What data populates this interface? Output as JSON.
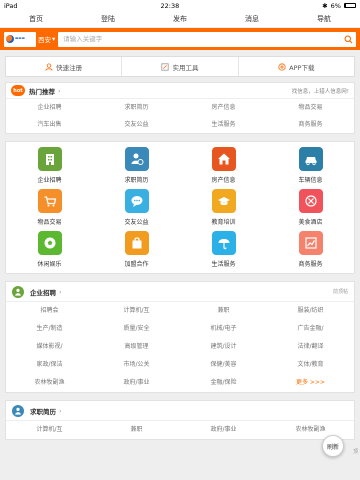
{
  "status_bar": {
    "device": "iPad",
    "time": "22:38",
    "battery": "6%"
  },
  "topnav": [
    "首页",
    "登陆",
    "发布",
    "消息",
    "导航"
  ],
  "search": {
    "city": "西安",
    "placeholder": "请输入关键字"
  },
  "quick_links": [
    "快速注册",
    "实用工具",
    "APP下载"
  ],
  "hot": {
    "badge": "hot",
    "title": "热门推荐",
    "arrow": "›",
    "tip": "找信息，上猎人信息网!",
    "items": [
      "企业招聘",
      "求职简历",
      "房产信息",
      "物品交易",
      "汽车出售",
      "交友公益",
      "生活服务",
      "商务服务"
    ]
  },
  "categories": [
    {
      "label": "企业招聘",
      "icon": "building-icon",
      "color": "#6aa53b"
    },
    {
      "label": "求职简历",
      "icon": "person-clock-icon",
      "color": "#3a89b8"
    },
    {
      "label": "房产信息",
      "icon": "house-icon",
      "color": "#e8561f"
    },
    {
      "label": "车辆信息",
      "icon": "car-icon",
      "color": "#2c7fa6"
    },
    {
      "label": "物品交易",
      "icon": "cart-icon",
      "color": "#f58f2a"
    },
    {
      "label": "交友公益",
      "icon": "chat-icon",
      "color": "#3ab0e2"
    },
    {
      "label": "教育培训",
      "icon": "graduation-cap-icon",
      "color": "#f2a922"
    },
    {
      "label": "美食酒店",
      "icon": "fork-knife-icon",
      "color": "#f0535b"
    },
    {
      "label": "休闲娱乐",
      "icon": "soccer-ball-icon",
      "color": "#5cb831"
    },
    {
      "label": "加盟合作",
      "icon": "shopping-bag-icon",
      "color": "#f29c1f"
    },
    {
      "label": "生活服务",
      "icon": "umbrella-icon",
      "color": "#2bb0e8"
    },
    {
      "label": "商务服务",
      "icon": "chart-icon",
      "color": "#f4826c"
    }
  ],
  "jobs": {
    "title": "企业招聘",
    "arrow": "›",
    "more": "前顶帖",
    "items": [
      "招聘会",
      "计算机/互",
      "兼职",
      "服装/纺织",
      "生产/制造",
      "质量/安全",
      "机械/电子",
      "广告金融/",
      "媒体影视/",
      "高级管理",
      "建筑/设计",
      "法律/翻译",
      "家政/保洁",
      "市场/公关",
      "保健/美容",
      "文体/教育",
      "农林牧副渔",
      "政府/事业",
      "金融/保险",
      "更多 >>>"
    ]
  },
  "resumes": {
    "title": "求职简历",
    "arrow": "›",
    "items": [
      "计算机/互",
      "兼职",
      "政府/事业",
      "农林牧副渔"
    ]
  },
  "refresh_label": "刷新",
  "side_label": "顶"
}
